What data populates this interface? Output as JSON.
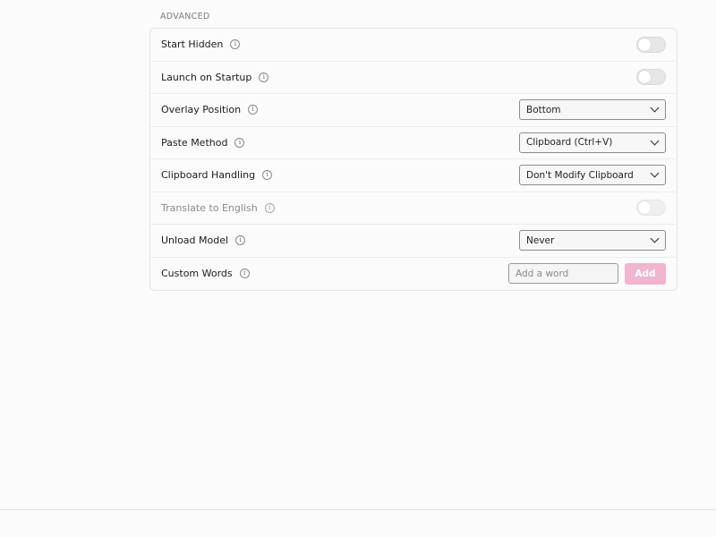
{
  "section": {
    "title": "ADVANCED"
  },
  "settings": {
    "start_hidden": {
      "label": "Start Hidden",
      "enabled": false
    },
    "launch_on_startup": {
      "label": "Launch on Startup",
      "enabled": false
    },
    "overlay_position": {
      "label": "Overlay Position",
      "value": "Bottom"
    },
    "paste_method": {
      "label": "Paste Method",
      "value": "Clipboard (Ctrl+V)"
    },
    "clipboard_handling": {
      "label": "Clipboard Handling",
      "value": "Don't Modify Clipboard"
    },
    "translate_to_english": {
      "label": "Translate to English",
      "enabled": false,
      "disabled": true
    },
    "unload_model": {
      "label": "Unload Model",
      "value": "Never"
    },
    "custom_words": {
      "label": "Custom Words",
      "placeholder": "Add a word",
      "add_label": "Add"
    }
  },
  "icons": {
    "info": "info-icon",
    "dropdown": "chevron-down-icon"
  },
  "colors": {
    "accent": "#f0b5cf"
  }
}
